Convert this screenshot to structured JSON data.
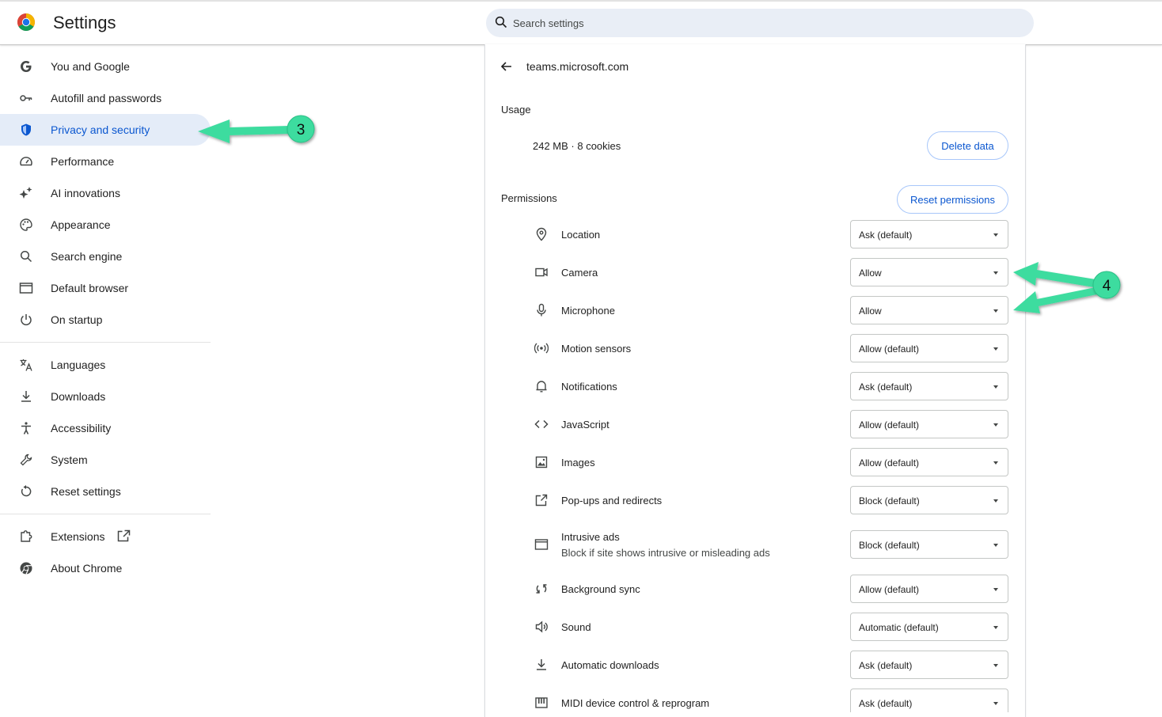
{
  "header": {
    "title": "Settings",
    "search_placeholder": "Search settings"
  },
  "sidebar": {
    "items": [
      {
        "label": "You and Google",
        "icon": "google-g-icon"
      },
      {
        "label": "Autofill and passwords",
        "icon": "key-icon"
      },
      {
        "label": "Privacy and security",
        "icon": "shield-icon",
        "active": true
      },
      {
        "label": "Performance",
        "icon": "speedometer-icon"
      },
      {
        "label": "AI innovations",
        "icon": "sparkle-icon"
      },
      {
        "label": "Appearance",
        "icon": "palette-icon"
      },
      {
        "label": "Search engine",
        "icon": "search-icon"
      },
      {
        "label": "Default browser",
        "icon": "browser-window-icon"
      },
      {
        "label": "On startup",
        "icon": "power-icon"
      },
      {
        "label": "Languages",
        "icon": "translate-icon"
      },
      {
        "label": "Downloads",
        "icon": "download-icon"
      },
      {
        "label": "Accessibility",
        "icon": "accessibility-icon"
      },
      {
        "label": "System",
        "icon": "wrench-icon"
      },
      {
        "label": "Reset settings",
        "icon": "reset-icon"
      },
      {
        "label": "Extensions",
        "icon": "puzzle-icon"
      },
      {
        "label": "About Chrome",
        "icon": "chrome-icon"
      }
    ]
  },
  "site": {
    "title": "teams.microsoft.com",
    "usage_heading": "Usage",
    "usage_text": "242 MB · 8 cookies",
    "delete_button": "Delete data",
    "permissions_heading": "Permissions",
    "reset_button": "Reset permissions",
    "permissions": [
      {
        "name": "Location",
        "value": "Ask (default)",
        "icon": "location-pin-icon"
      },
      {
        "name": "Camera",
        "value": "Allow",
        "icon": "camera-icon"
      },
      {
        "name": "Microphone",
        "value": "Allow",
        "icon": "microphone-icon"
      },
      {
        "name": "Motion sensors",
        "value": "Allow (default)",
        "icon": "motion-sensor-icon"
      },
      {
        "name": "Notifications",
        "value": "Ask (default)",
        "icon": "bell-icon"
      },
      {
        "name": "JavaScript",
        "value": "Allow (default)",
        "icon": "code-icon"
      },
      {
        "name": "Images",
        "value": "Allow (default)",
        "icon": "image-icon"
      },
      {
        "name": "Pop-ups and redirects",
        "value": "Block (default)",
        "icon": "open-external-icon"
      },
      {
        "name": "Intrusive ads",
        "sub": "Block if site shows intrusive or misleading ads",
        "value": "Block (default)",
        "icon": "ad-window-icon"
      },
      {
        "name": "Background sync",
        "value": "Allow (default)",
        "icon": "sync-icon"
      },
      {
        "name": "Sound",
        "value": "Automatic (default)",
        "icon": "speaker-icon"
      },
      {
        "name": "Automatic downloads",
        "value": "Ask (default)",
        "icon": "download-icon"
      },
      {
        "name": "MIDI device control & reprogram",
        "value": "Ask (default)",
        "icon": "piano-icon"
      }
    ]
  },
  "annotations": {
    "step3": "3",
    "step4": "4",
    "arrow_color": "#3ddc9f"
  }
}
